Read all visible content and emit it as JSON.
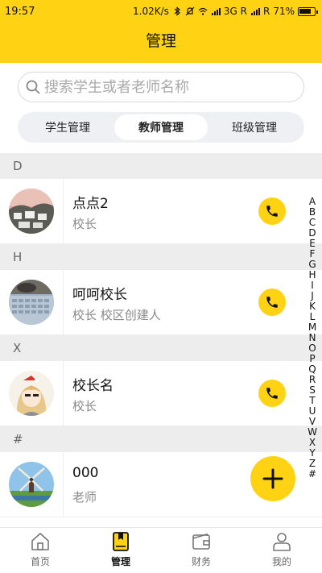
{
  "status_bar": {
    "time": "19:57",
    "speed": "1.02K/s",
    "network": "3G R",
    "roaming": "R",
    "battery": "71%"
  },
  "header": {
    "title": "管理"
  },
  "search": {
    "placeholder": "搜索学生或者老师名称"
  },
  "tabs": [
    {
      "label": "学生管理",
      "active": false
    },
    {
      "label": "教师管理",
      "active": true
    },
    {
      "label": "班级管理",
      "active": false
    }
  ],
  "sections": [
    {
      "letter": "D",
      "items": [
        {
          "name": "点点2",
          "role": "校长"
        }
      ]
    },
    {
      "letter": "H",
      "items": [
        {
          "name": "呵呵校长",
          "role": "校长 校区创建人"
        }
      ]
    },
    {
      "letter": "X",
      "items": [
        {
          "name": "校长名",
          "role": "校长"
        }
      ]
    },
    {
      "letter": "#",
      "items": [
        {
          "name": "000",
          "role": "老师"
        }
      ]
    }
  ],
  "alphabet_index": [
    "A",
    "B",
    "C",
    "D",
    "E",
    "F",
    "G",
    "H",
    "I",
    "J",
    "K",
    "L",
    "M",
    "N",
    "O",
    "P",
    "Q",
    "R",
    "S",
    "T",
    "U",
    "V",
    "W",
    "X",
    "Y",
    "Z",
    "#"
  ],
  "bottom_nav": [
    {
      "label": "首页",
      "icon": "home-icon",
      "active": false
    },
    {
      "label": "管理",
      "icon": "manage-icon",
      "active": true
    },
    {
      "label": "财务",
      "icon": "wallet-icon",
      "active": false
    },
    {
      "label": "我的",
      "icon": "user-icon",
      "active": false
    }
  ],
  "colors": {
    "accent": "#FFD314",
    "section_bg": "#EDEDED",
    "muted_text": "#8A8A8A"
  }
}
